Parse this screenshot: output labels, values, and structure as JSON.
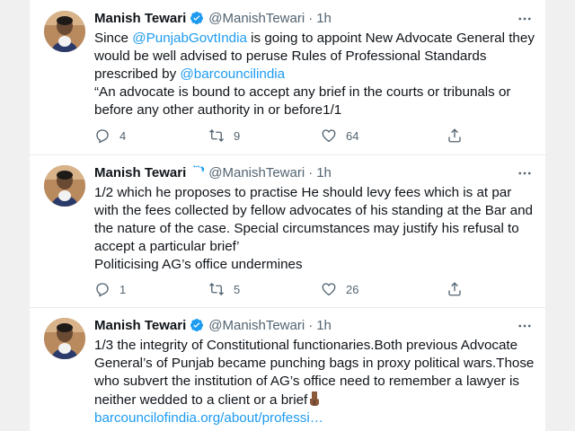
{
  "author": {
    "name": "Manish Tewari",
    "handle": "@ManishTewari",
    "separator": "·"
  },
  "colors": {
    "link": "#1d9bf0",
    "verified": "#1d9bf0",
    "muted": "#536471"
  },
  "tweets": [
    {
      "time": "1h",
      "text_parts": [
        "Since ",
        "@PunjabGovtIndia",
        " is going to appoint New Advocate General they would be well advised to peruse Rules of Professional Standards prescribed by ",
        "@barcouncilindia"
      ],
      "quote": "“An advocate is bound to accept any brief in the courts or tribunals or before any other authority in or before1/1",
      "replies": "4",
      "retweets": "9",
      "likes": "64"
    },
    {
      "time": "1h",
      "text": "1/2 which he proposes to practise He should levy fees which is at par with the fees collected by fellow advocates of his standing at the Bar and the nature of the case. Special circumstances may justify his refusal to accept a particular brief’",
      "text2": "Politicising AG’s office undermines",
      "replies": "1",
      "retweets": "5",
      "likes": "26"
    },
    {
      "time": "1h",
      "text": "1/3 the integrity of Constitutional functionaries.Both previous Advocate General’s of Punjab became punching bags in proxy political wars.Those who subvert the institution of AG’s office need to remember a lawyer is neither wedded to a client or a brief",
      "emoji": "point-down-hand-emoji",
      "link": "barcouncilofindia.org/about/professi…"
    }
  ],
  "icons": {
    "more": "more-dots-icon",
    "reply": "reply-icon",
    "retweet": "retweet-icon",
    "like": "heart-icon",
    "share": "share-icon",
    "verified": "verified-badge-icon"
  }
}
